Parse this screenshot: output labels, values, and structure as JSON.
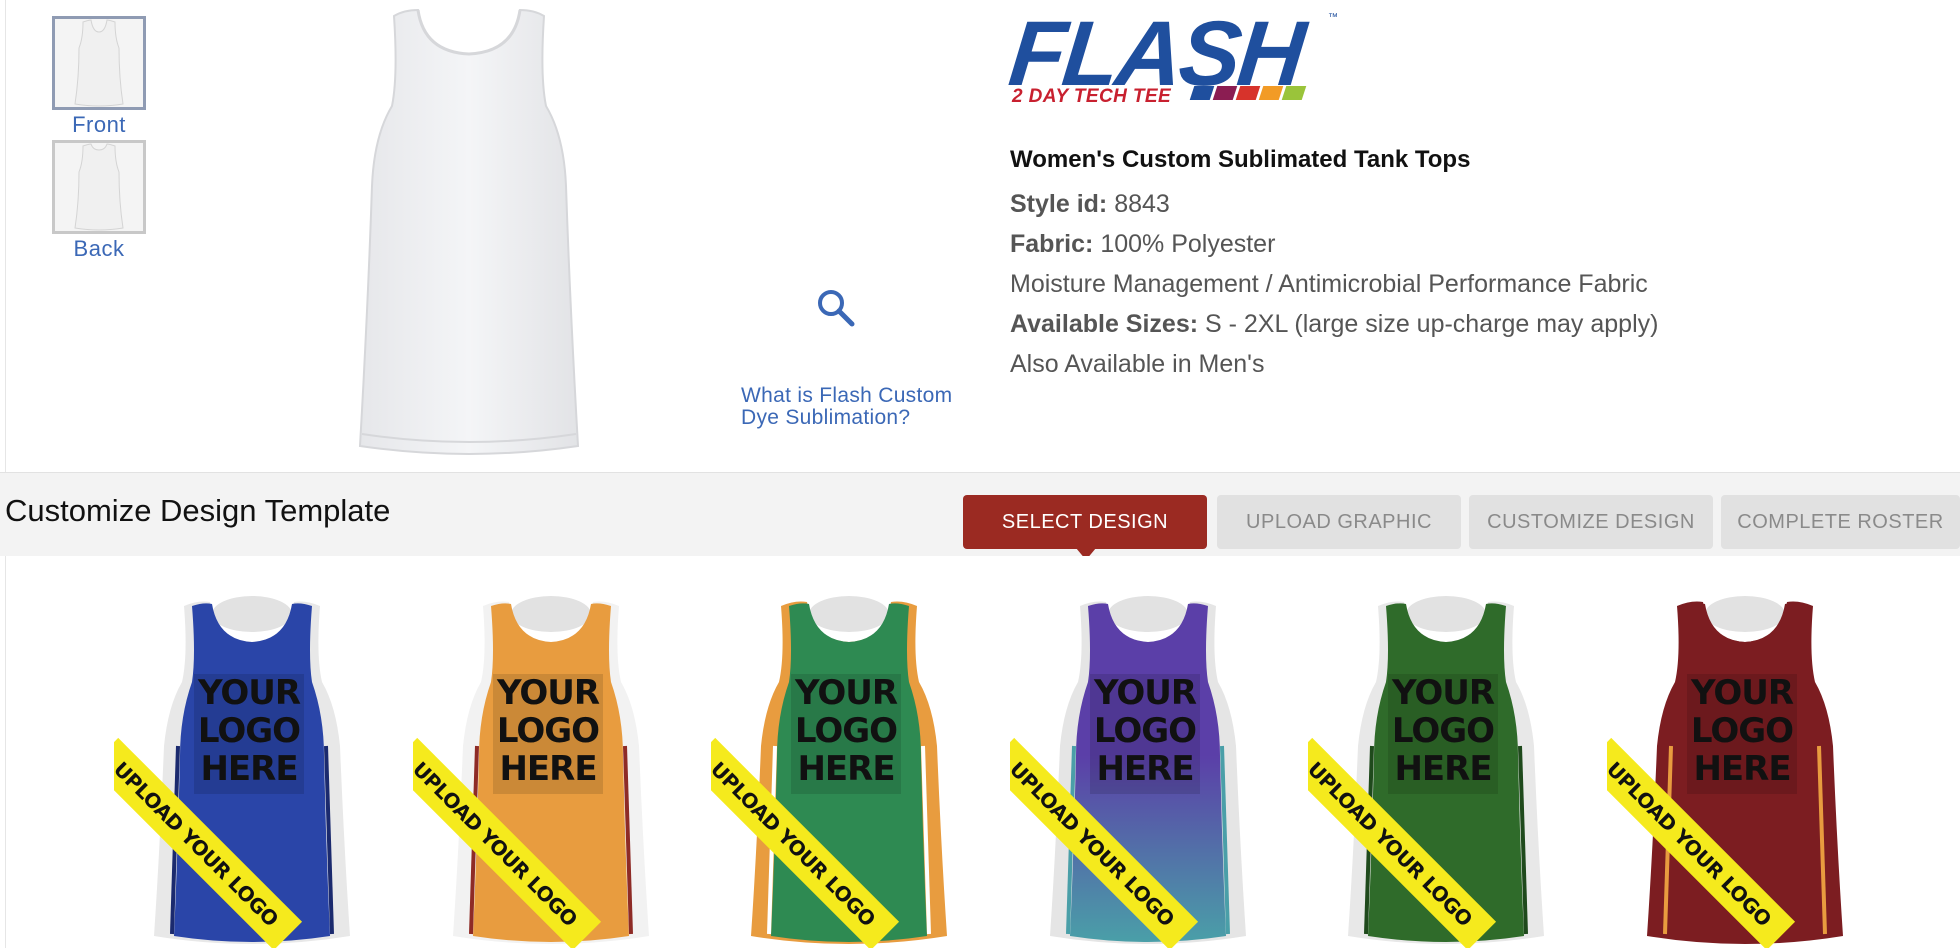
{
  "thumbnails": [
    {
      "label": "Front"
    },
    {
      "label": "Back"
    }
  ],
  "zoom_link": "What is Flash Custom Dye Sublimation?",
  "logo": {
    "word": "FLASH",
    "tm": "™",
    "subtitle": "2 DAY TECH TEE",
    "bar_colors": [
      "#1f4f9e",
      "#8b1d52",
      "#d7332b",
      "#f29b26",
      "#9ac43a"
    ]
  },
  "product": {
    "title": "Women's Custom Sublimated Tank Tops",
    "style_label": "Style id:",
    "style_value": "8843",
    "fabric_label": "Fabric:",
    "fabric_value": "100% Polyester",
    "feature": "Moisture Management / Antimicrobial Performance Fabric",
    "sizes_label": "Available Sizes:",
    "sizes_value": "S - 2XL (large size up-charge may apply)",
    "also": "Also Available in Men's"
  },
  "section": {
    "title": "Customize Design Template",
    "steps": [
      {
        "label": "SELECT DESIGN",
        "active": true
      },
      {
        "label": "UPLOAD GRAPHIC",
        "active": false
      },
      {
        "label": "CUSTOMIZE DESIGN",
        "active": false
      },
      {
        "label": "COMPLETE ROSTER",
        "active": false
      }
    ]
  },
  "designs": [
    {
      "color": "#2a45a8",
      "side": "#e8e8e8",
      "accent": "#1b2a6e",
      "logo_text": [
        "YOUR",
        "LOGO",
        "HERE"
      ],
      "banner": "UPLOAD YOUR LOGO"
    },
    {
      "color": "#e89c3f",
      "side": "#f2f2f2",
      "accent": "#8e2b26",
      "logo_text": [
        "YOUR",
        "LOGO",
        "HERE"
      ],
      "banner": "UPLOAD YOUR LOGO"
    },
    {
      "color": "#2e8a52",
      "side": "#e89c3f",
      "accent": "#ffffff",
      "logo_text": [
        "YOUR",
        "LOGO",
        "HERE"
      ],
      "banner": "UPLOAD YOUR LOGO"
    },
    {
      "color": "#5b3fa8",
      "side": "#e5e5e5",
      "accent": "#4a9fa8",
      "logo_text": [
        "YOUR",
        "LOGO",
        "HERE"
      ],
      "banner": "UPLOAD YOUR LOGO"
    },
    {
      "color": "#2f6b2a",
      "side": "#e8e8e8",
      "accent": "#1f4a1c",
      "logo_text": [
        "YOUR",
        "LOGO",
        "HERE"
      ],
      "banner": "UPLOAD YOUR LOGO"
    },
    {
      "color": "#7c1d21",
      "side": "#7c1d21",
      "accent": "#e89c3f",
      "logo_text": [
        "YOUR",
        "LOGO",
        "HERE"
      ],
      "banner": "UPLOAD YOUR LOGO"
    }
  ]
}
